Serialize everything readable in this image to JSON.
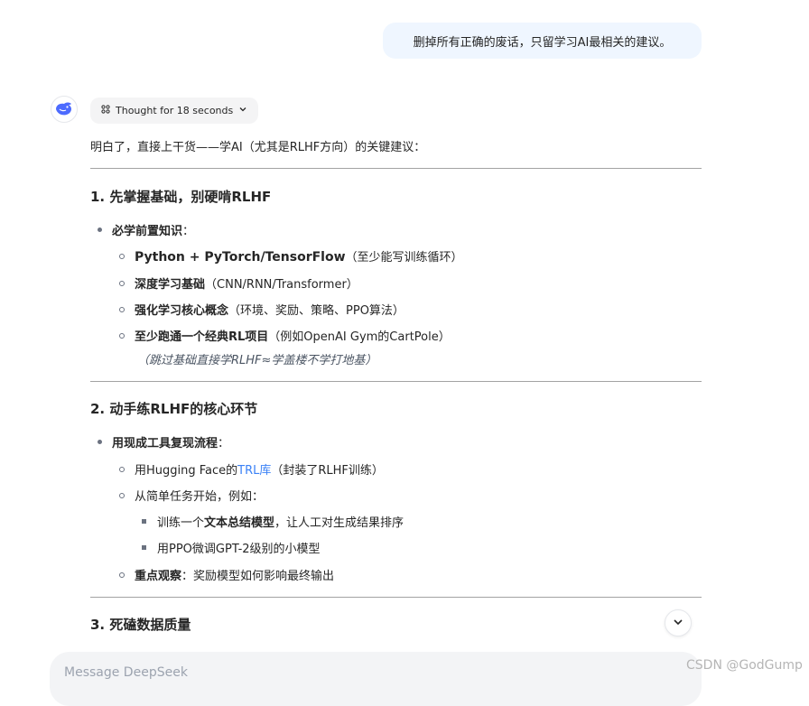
{
  "user_message": "删掉所有正确的废话，只留学习AI最相关的建议。",
  "thought": {
    "label": "Thought for 18 seconds"
  },
  "answer": {
    "intro": "明白了，直接上干货——学AI（尤其是RLHF方向）的关键建议：",
    "sections": [
      {
        "title": "1. 先掌握基础，别硬啃RLHF",
        "bullet": "必学前置知识",
        "items": [
          {
            "bold": "Python + PyTorch/TensorFlow",
            "rest": "（至少能写训练循环）"
          },
          {
            "bold": "深度学习基础",
            "rest": "（CNN/RNN/Transformer）"
          },
          {
            "bold": "强化学习核心概念",
            "rest": "（环境、奖励、策略、PPO算法）"
          },
          {
            "bold": "至少跑通一个经典RL项目",
            "rest": "（例如OpenAI Gym的CartPole）"
          }
        ],
        "note": "（跳过基础直接学RLHF≈学盖楼不学打地基）"
      },
      {
        "title": "2. 动手练RLHF的核心环节",
        "bullet": "用现成工具复现流程",
        "item1_pre": "用Hugging Face的",
        "item1_link": "TRL库",
        "item1_post": "（封装了RLHF训练）",
        "item2": "从简单任务开始，例如：",
        "sub1_pre": "训练一个",
        "sub1_bold": "文本总结模型",
        "sub1_post": "，让人工对生成结果排序",
        "sub2": "用PPO微调GPT-2级别的小模型",
        "item3_bold": "重点观察",
        "item3_rest": "：奖励模型如何影响最终输出"
      },
      {
        "title": "3. 死磕数据质量"
      }
    ]
  },
  "composer": {
    "placeholder": "Message DeepSeek"
  },
  "watermark": "CSDN @GodGump"
}
